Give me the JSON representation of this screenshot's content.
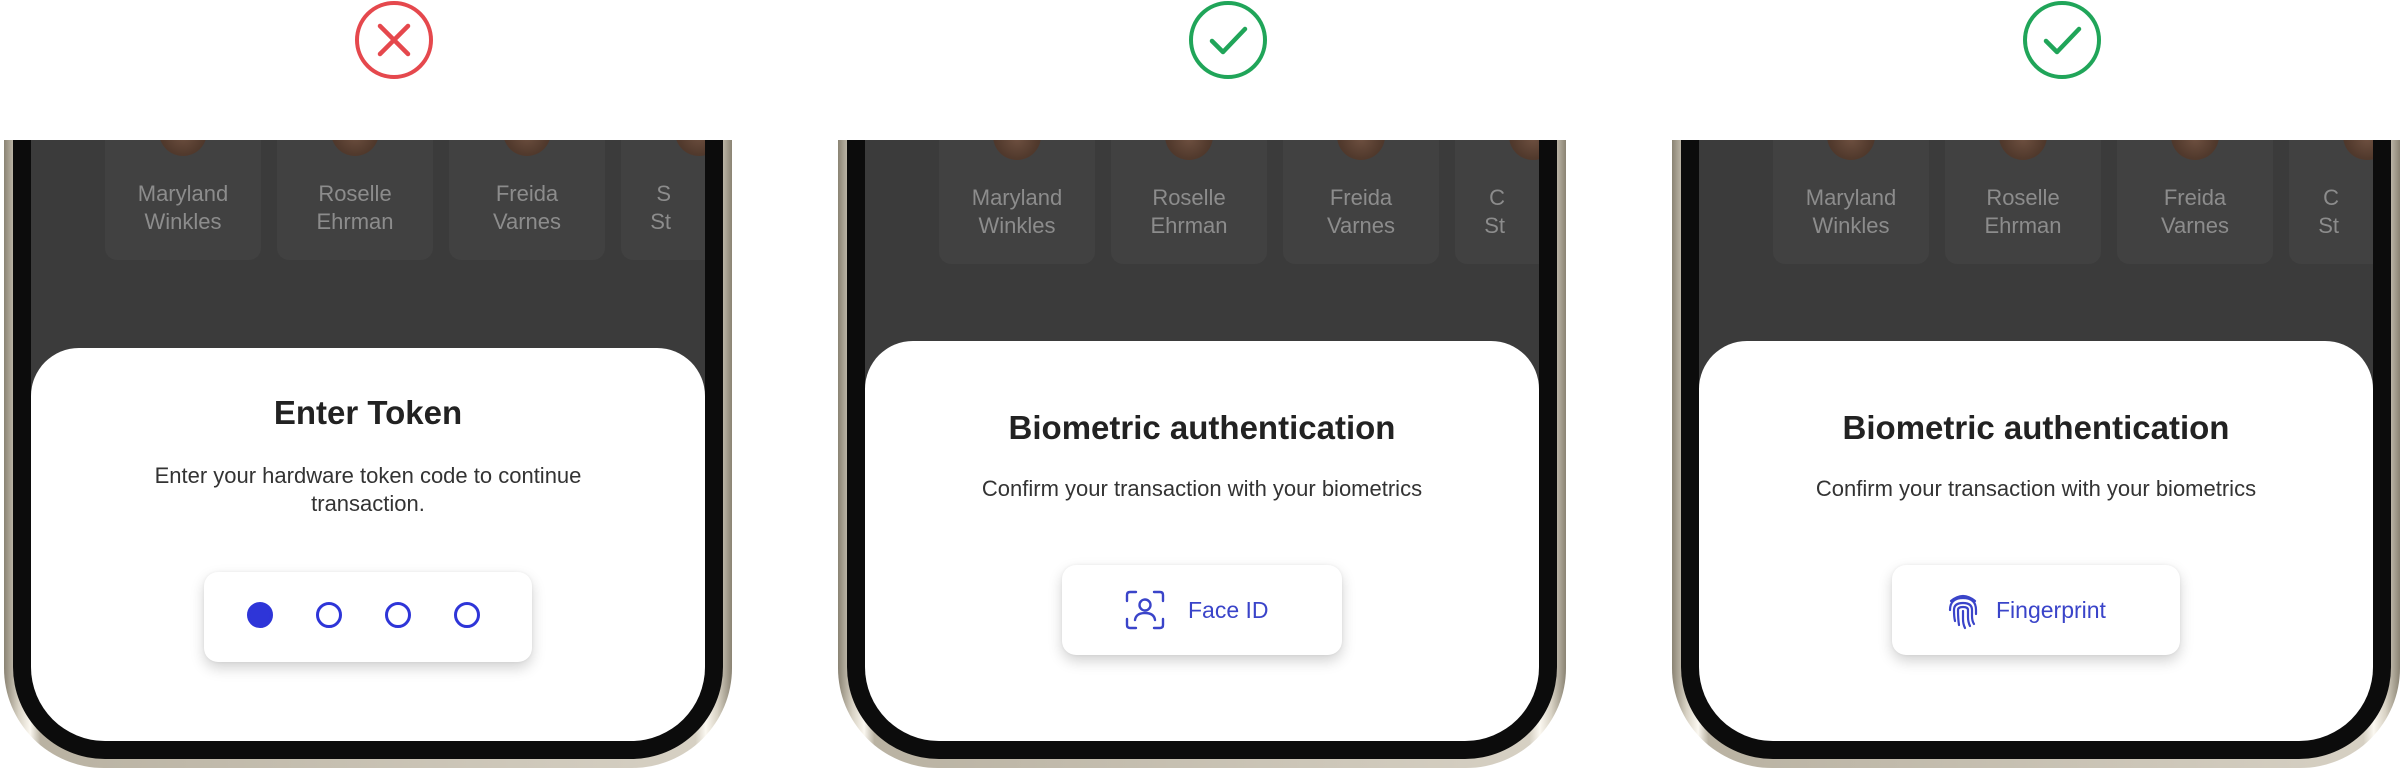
{
  "colors": {
    "wrong": "#e5484d",
    "correct": "#20a559",
    "accent": "#2e35d8",
    "overlay": "#3b3b3b"
  },
  "panels": [
    {
      "verdict": "wrong",
      "verdict_icon": "x-circle-icon",
      "contacts": [
        "Maryland\nWinkles",
        "Roselle\nEhrman",
        "Freida\nVarnes",
        "S\nSt"
      ],
      "sheet": {
        "title": "Enter Token",
        "description": "Enter your hardware token code to continue transaction.",
        "token_digits_entered": 1,
        "token_length": 4
      }
    },
    {
      "verdict": "correct",
      "verdict_icon": "check-circle-icon",
      "contacts": [
        "Maryland\nWinkles",
        "Roselle\nEhrman",
        "Freida\nVarnes",
        "C\nSt"
      ],
      "sheet": {
        "title": "Biometric authentication",
        "description": "Confirm your transaction with your biometrics",
        "button_label": "Face ID",
        "button_icon": "face-id-icon"
      }
    },
    {
      "verdict": "correct",
      "verdict_icon": "check-circle-icon",
      "contacts": [
        "Maryland\nWinkles",
        "Roselle\nEhrman",
        "Freida\nVarnes",
        "C\nSt"
      ],
      "sheet": {
        "title": "Biometric authentication",
        "description": "Confirm your transaction with your biometrics",
        "button_label": "Fingerprint",
        "button_icon": "fingerprint-icon"
      }
    }
  ]
}
